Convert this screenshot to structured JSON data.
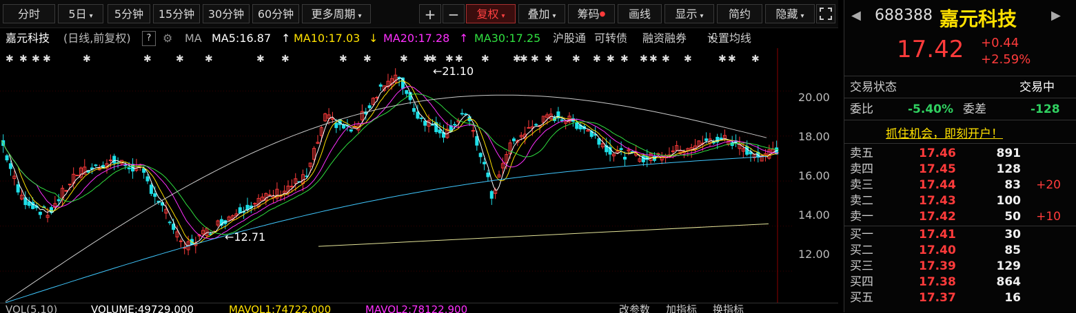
{
  "toolbar": {
    "buttons": [
      "分时",
      "5日",
      "5分钟",
      "15分钟",
      "30分钟",
      "60分钟",
      "更多周期"
    ],
    "icons": [
      "plus-icon",
      "minus-icon"
    ],
    "fuquan": "复权",
    "overlay": "叠加",
    "chips": "筹码",
    "draw": "画线",
    "display": "显示",
    "simple": "简约",
    "hide": "隐藏"
  },
  "info": {
    "name": "嘉元科技",
    "mode": "(日线,前复权)",
    "help": "?",
    "ma_label": "MA",
    "ma5": "MA5:16.87",
    "ma10": "MA10:17.03",
    "ma20": "MA20:17.28",
    "ma30": "MA30:17.25",
    "links": [
      "沪股通",
      "可转债",
      "融资融券",
      "设置均线"
    ]
  },
  "chart_data": {
    "type": "candlestick",
    "ylim": [
      10.6,
      21.9
    ],
    "yticks": [
      "20.00",
      "18.00",
      "16.00",
      "14.00",
      "12.00"
    ],
    "annotations": {
      "high": "21.10",
      "low": "12.71"
    },
    "colors": {
      "up": "#ff3b3b",
      "down": "#1fdfe8",
      "ma5": "#ffffff",
      "ma10": "#ffe100",
      "ma20": "#ff30ff",
      "ma30": "#30e040",
      "ma60": "#cccccc",
      "ma120": "#40c8ff",
      "ma250": "#e6e69a"
    }
  },
  "volume": {
    "label": "VOL(5,10)",
    "volume": "VOLUME:49729.000",
    "mavol1": "MAVOL1:74722.000",
    "mavol2": "MAVOL2:78122.900",
    "links": [
      "改参数",
      "加指标",
      "换指标"
    ]
  },
  "quote": {
    "code": "688388",
    "name": "嘉元科技",
    "price": "17.42",
    "change": "+0.44",
    "pct": "+2.59%",
    "status_label": "交易状态",
    "status": "交易中",
    "weibi_label": "委比",
    "weibi": "-5.40%",
    "weicha_label": "委差",
    "weicha": "-128",
    "promo": "抓住机会，即刻开户！",
    "sell": [
      {
        "label": "卖五",
        "price": "17.46",
        "vol": "891",
        "chg": ""
      },
      {
        "label": "卖四",
        "price": "17.45",
        "vol": "128",
        "chg": ""
      },
      {
        "label": "卖三",
        "price": "17.44",
        "vol": "83",
        "chg": "+20"
      },
      {
        "label": "卖二",
        "price": "17.43",
        "vol": "100",
        "chg": ""
      },
      {
        "label": "卖一",
        "price": "17.42",
        "vol": "50",
        "chg": "+10"
      }
    ],
    "buy": [
      {
        "label": "买一",
        "price": "17.41",
        "vol": "30"
      },
      {
        "label": "买二",
        "price": "17.40",
        "vol": "85"
      },
      {
        "label": "买三",
        "price": "17.39",
        "vol": "129"
      },
      {
        "label": "买四",
        "price": "17.38",
        "vol": "864"
      },
      {
        "label": "买五",
        "price": "17.37",
        "vol": "16"
      }
    ]
  }
}
